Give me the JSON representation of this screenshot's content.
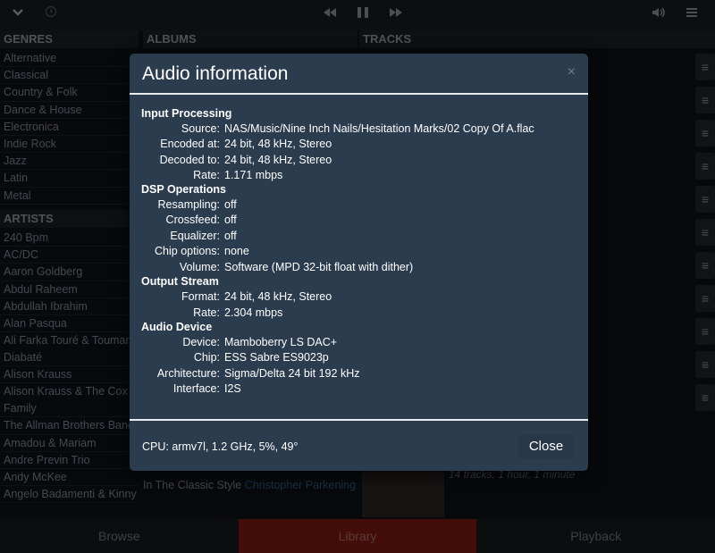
{
  "headers": {
    "genres": "GENRES",
    "albums": "ALBUMS",
    "tracks": "TRACKS",
    "artists": "ARTISTS"
  },
  "genres": [
    "Alternative",
    "Classical",
    "Country & Folk",
    "Dance & House",
    "Electronica",
    "Indie Rock",
    "Jazz",
    "Latin",
    "Metal"
  ],
  "artists": [
    "240 Bpm",
    "AC/DC",
    "Aaron Goldberg",
    "Abdul Raheem",
    "Abdullah Ibrahim",
    "Alan Pasqua",
    "Ali Farka Touré & Toumani Diabaté",
    "Alison Krauss",
    "Alison Krauss & The Cox Family",
    "The Allman Brothers Band",
    "Amadou & Mariam",
    "Andre Previn Trio",
    "Andy McKee",
    "Angelo Badamenti & Kinny"
  ],
  "albums_visible": {
    "title": "In The Classic Style",
    "artist": "Christopher Parkening"
  },
  "tracks_note": "14 tracks, 1 hour, 1 minute",
  "tabs": [
    "Browse",
    "Library",
    "Playback"
  ],
  "icons": {
    "collapse": "chevron-down-icon",
    "clock": "clock-icon",
    "prev": "skip-back-icon",
    "pause": "pause-icon",
    "next": "skip-forward-icon",
    "volume": "volume-icon",
    "menu": "hamburger-icon"
  },
  "modal": {
    "title": "Audio information",
    "close_x": "×",
    "sections": {
      "input": {
        "heading": "Input Processing",
        "source_label": "Source:",
        "source": "NAS/Music/Nine Inch Nails/Hesitation Marks/02 Copy Of A.flac",
        "encoded_label": "Encoded at:",
        "encoded": "24 bit, 48 kHz, Stereo",
        "decoded_label": "Decoded to:",
        "decoded": "24 bit, 48 kHz, Stereo",
        "rate_label": "Rate:",
        "rate": "1.171 mbps"
      },
      "dsp": {
        "heading": "DSP Operations",
        "resampling_label": "Resampling:",
        "resampling": "off",
        "crossfeed_label": "Crossfeed:",
        "crossfeed": "off",
        "equalizer_label": "Equalizer:",
        "equalizer": "off",
        "chip_label": "Chip options:",
        "chip": "none",
        "volume_label": "Volume:",
        "volume": "Software (MPD 32-bit float with dither)"
      },
      "output": {
        "heading": "Output Stream",
        "format_label": "Format:",
        "format": "24 bit, 48 kHz, Stereo",
        "rate_label": "Rate:",
        "rate": "2.304 mbps"
      },
      "device": {
        "heading": "Audio Device",
        "device_label": "Device:",
        "device": "Mamboberry LS DAC+",
        "chip_label": "Chip:",
        "chip": "ESS Sabre ES9023p",
        "arch_label": "Architecture:",
        "arch": "Sigma/Delta 24 bit 192 kHz",
        "iface_label": "Interface:",
        "iface": "I2S"
      }
    },
    "footer": "CPU: armv7l, 1.2 GHz, 5%, 49°",
    "close_label": "Close"
  }
}
